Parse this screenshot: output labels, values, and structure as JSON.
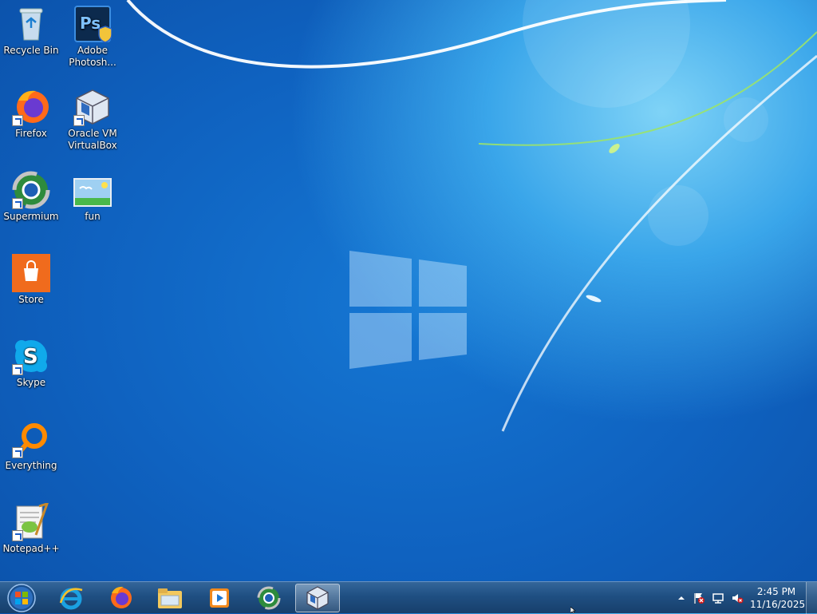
{
  "desktop": {
    "icons": [
      {
        "label": "Recycle Bin"
      },
      {
        "label": "Adobe\nPhotosh..."
      },
      {
        "label": "Firefox"
      },
      {
        "label": "Oracle VM\nVirtualBox"
      },
      {
        "label": "Supermium"
      },
      {
        "label": "fun"
      },
      {
        "label": "Store"
      },
      {
        "label": "Skype"
      },
      {
        "label": "Everything"
      },
      {
        "label": "Notepad++"
      }
    ]
  },
  "taskbar": {
    "clock_time": "2:45 PM",
    "clock_date": "11/16/2025",
    "pinned": [
      "Internet Explorer",
      "Firefox",
      "File Explorer",
      "Windows Media Player",
      "Supermium",
      "Oracle VM VirtualBox"
    ],
    "active": "Oracle VM VirtualBox"
  },
  "colors": {
    "desktop_blue": "#0f62c0",
    "taskbar": "#1f4f82"
  }
}
